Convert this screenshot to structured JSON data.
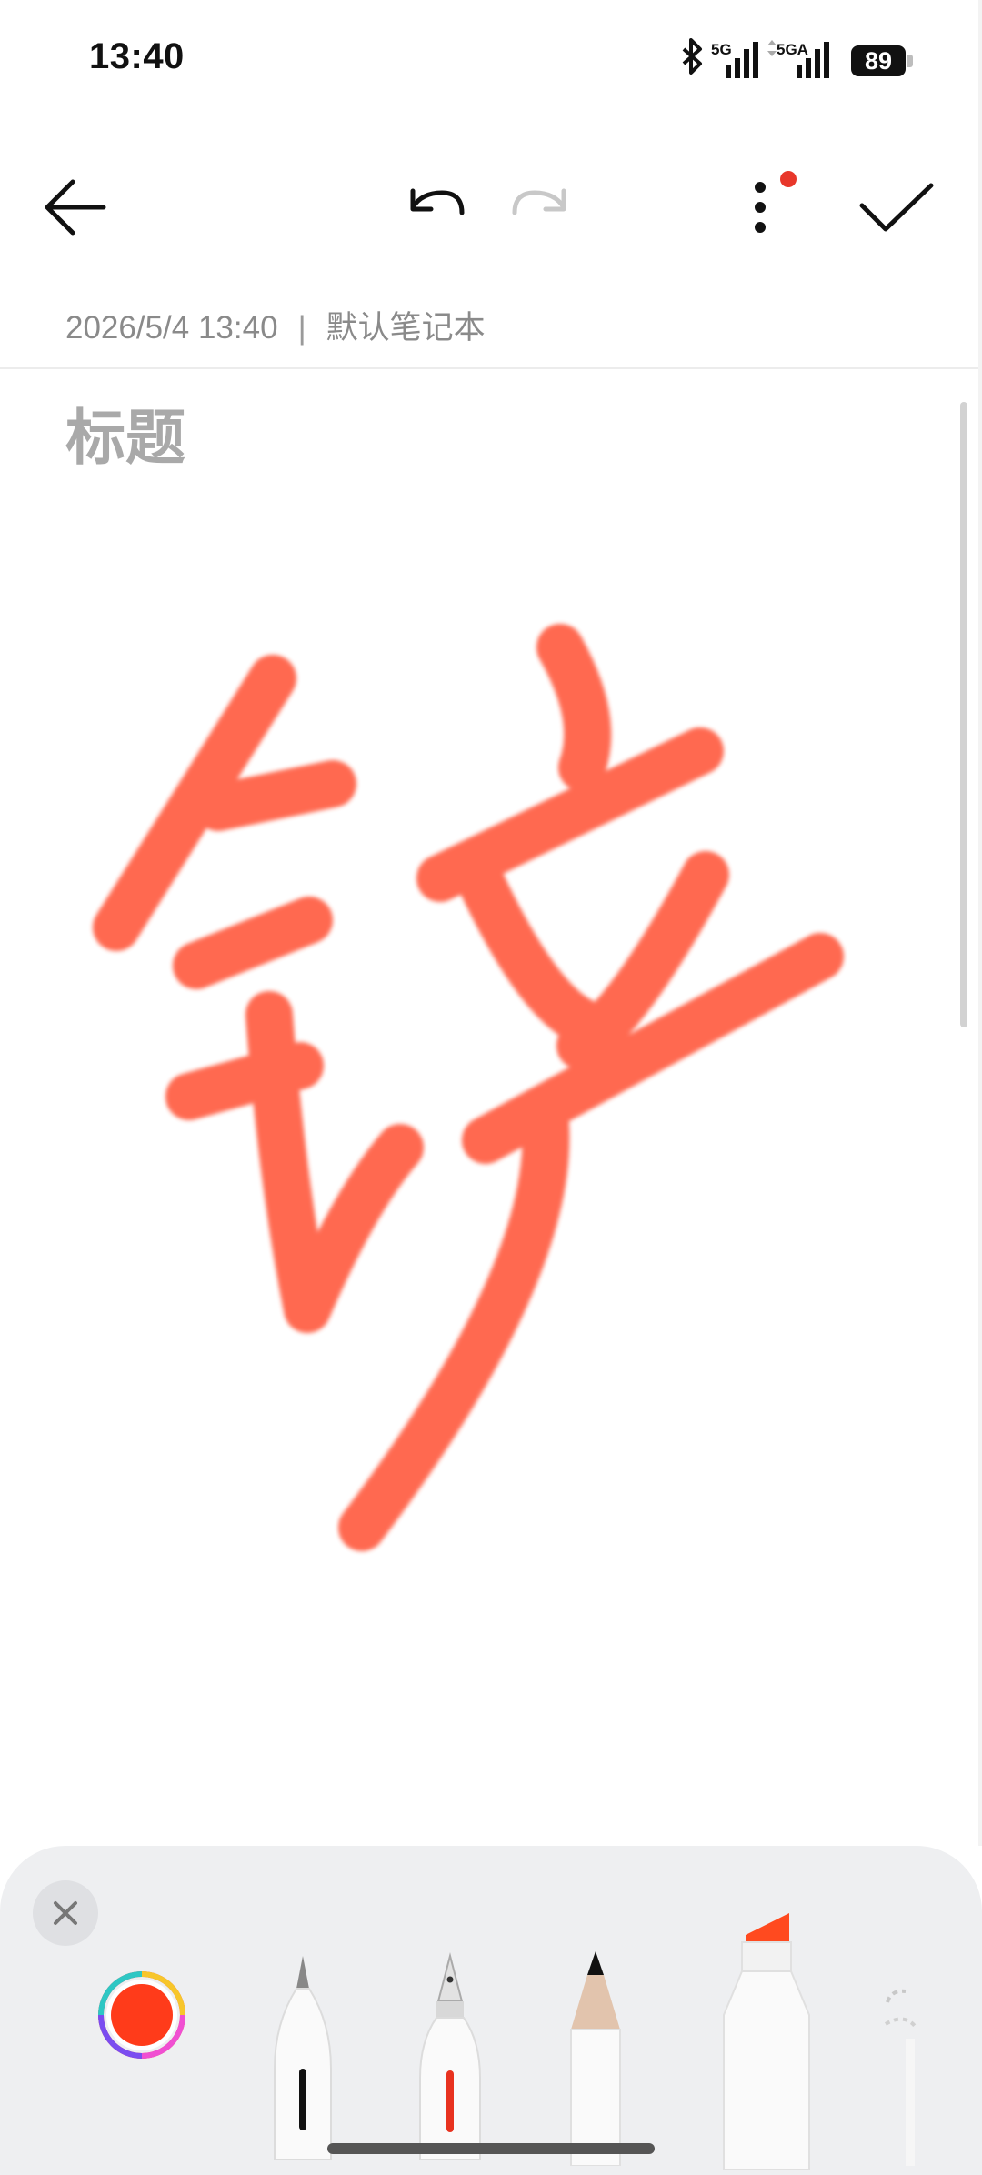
{
  "status_bar": {
    "time": "13:40",
    "network_1": "5G",
    "network_2": "5GA",
    "battery": "89",
    "icons": [
      "bluetooth-icon",
      "signal-5g-icon",
      "signal-5ga-icon",
      "battery-icon"
    ]
  },
  "toolbar": {
    "back_icon": "arrow-left-icon",
    "undo_icon": "undo-icon",
    "redo_icon": "redo-icon",
    "more_icon": "more-vertical-icon",
    "confirm_icon": "check-icon",
    "more_has_notification": true
  },
  "note": {
    "datetime": "2026/5/4 13:40",
    "separator": "|",
    "notebook": "默认笔记本",
    "title_placeholder": "标题"
  },
  "canvas": {
    "stroke_color": "#ff4a2a",
    "handwriting": "handwritten-character-drawing"
  },
  "pen_panel": {
    "close_icon": "close-icon",
    "selected_color": "#ff3b1a",
    "tools": [
      "ballpoint-pen",
      "fountain-pen",
      "pencil",
      "highlighter",
      "eraser"
    ],
    "selected_tool": "highlighter",
    "highlighter_color": "#ff4a1f"
  },
  "colors": {
    "accent_red": "#e8372a",
    "text_gray": "#8a8a8a",
    "panel_bg": "#eeeff1"
  }
}
